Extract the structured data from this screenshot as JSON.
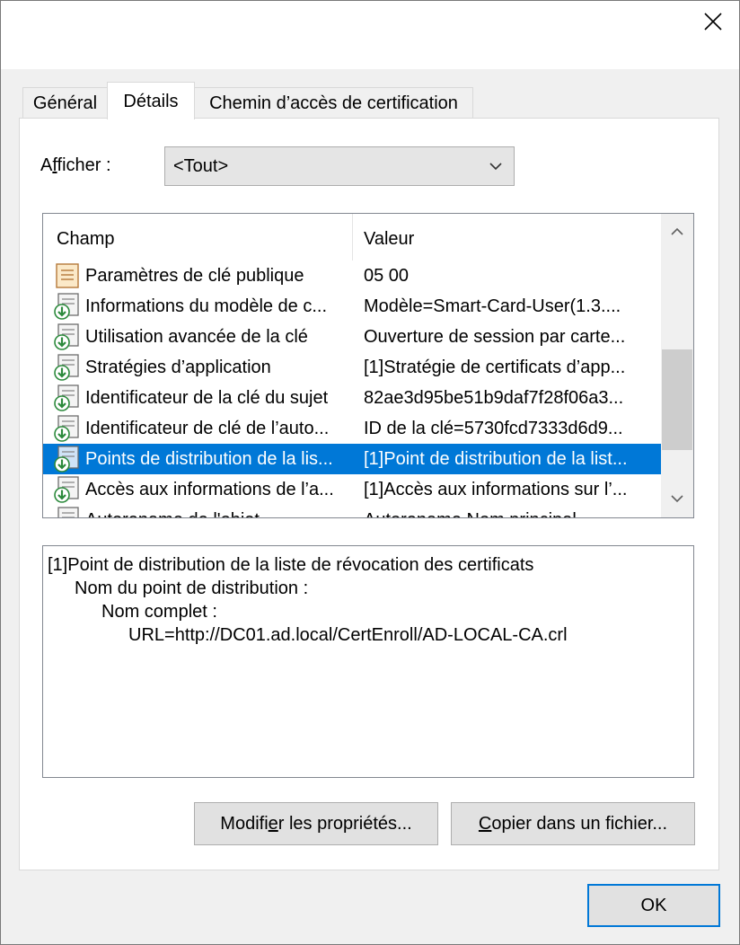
{
  "window": {
    "close_glyph": "×"
  },
  "tabs": [
    {
      "label": "Général"
    },
    {
      "label": "Détails"
    },
    {
      "label": "Chemin d’accès de certification"
    }
  ],
  "show": {
    "label_prefix": "A",
    "label_underlined": "f",
    "label_suffix": "ficher :",
    "selected": "<Tout>"
  },
  "list": {
    "headers": {
      "field": "Champ",
      "value": "Valeur"
    },
    "rows": [
      {
        "field": "Paramètres de clé publique",
        "value": "05 00",
        "icon": "certificate-field-icon"
      },
      {
        "field": "Informations du modèle de c...",
        "value": "Modèle=Smart-Card-User(1.3....",
        "icon": "extension-icon"
      },
      {
        "field": "Utilisation avancée de la clé",
        "value": "Ouverture de session par carte...",
        "icon": "extension-icon"
      },
      {
        "field": "Stratégies d’application",
        "value": "[1]Stratégie de certificats d’app...",
        "icon": "extension-icon"
      },
      {
        "field": "Identificateur de la clé du sujet",
        "value": "82ae3d95be51b9daf7f28f06a3...",
        "icon": "extension-icon"
      },
      {
        "field": "Identificateur de clé de l’auto...",
        "value": "ID de la clé=5730fcd7333d6d9...",
        "icon": "extension-icon"
      },
      {
        "field": "Points de distribution de la lis...",
        "value": "[1]Point de distribution de la list...",
        "icon": "extension-icon",
        "selected": true
      },
      {
        "field": "Accès aux informations de l’a...",
        "value": "[1]Accès aux informations sur l’...",
        "icon": "extension-icon"
      },
      {
        "field": "Autorename de l'objet...",
        "value": "Autorename Nom principal ...",
        "icon": "extension-icon"
      }
    ]
  },
  "details": {
    "lines": [
      "[1]Point de distribution de la liste de révocation des certificats",
      "Nom du point de distribution :",
      "Nom complet :",
      "URL=http://DC01.ad.local/CertEnroll/AD-LOCAL-CA.crl"
    ]
  },
  "buttons": {
    "edit_prefix": "Modifi",
    "edit_underlined": "e",
    "edit_suffix": "r les propriétés...",
    "copy_underlined": "C",
    "copy_suffix": "opier dans un fichier...",
    "ok": "OK"
  },
  "colors": {
    "selection": "#0078d7",
    "ok_border": "#0078d7"
  }
}
